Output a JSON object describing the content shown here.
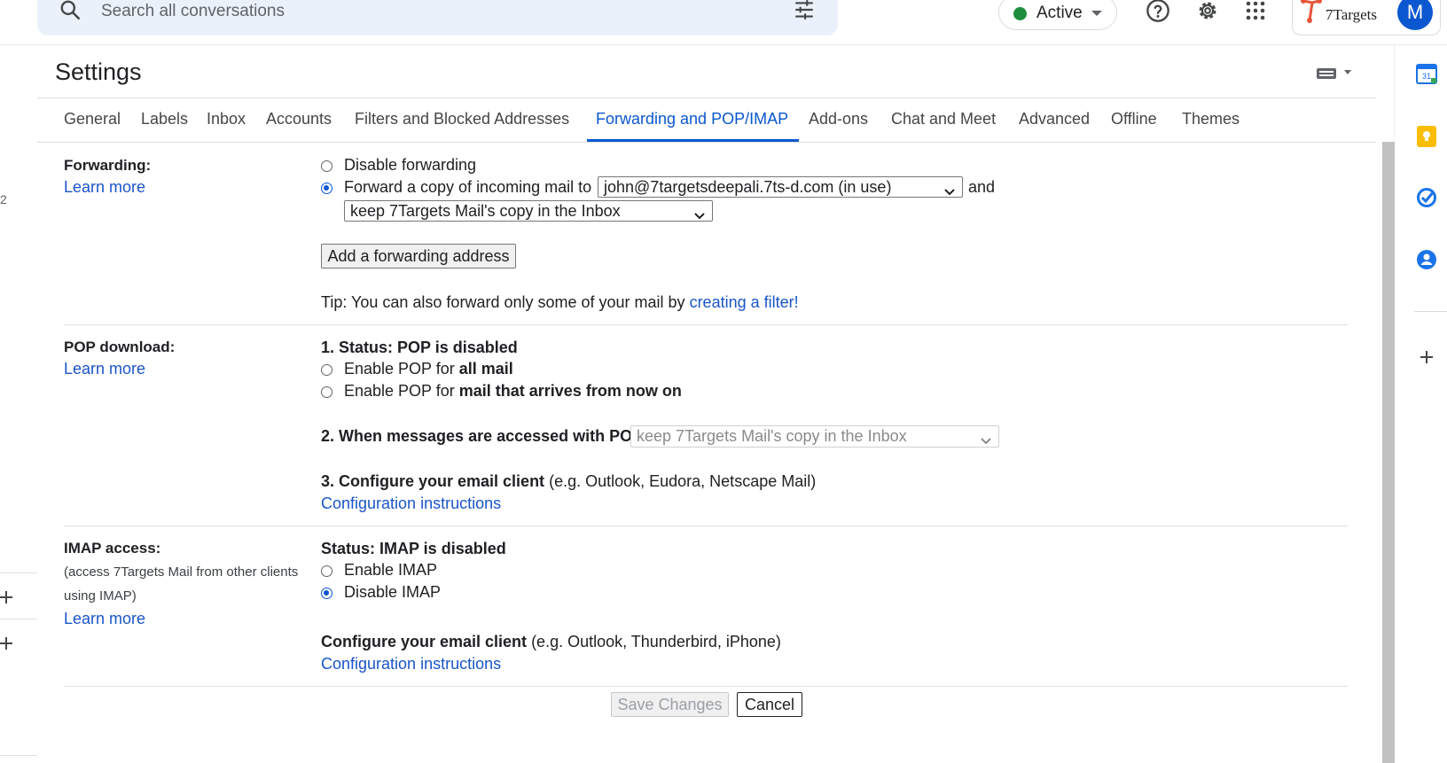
{
  "header": {
    "search_placeholder": "Search all conversations",
    "status_label": "Active",
    "brand_name": "7Targets",
    "avatar_letter": "M"
  },
  "left_fragment": "2",
  "settings": {
    "title": "Settings",
    "tabs": [
      "General",
      "Labels",
      "Inbox",
      "Accounts",
      "Filters and Blocked Addresses",
      "Forwarding and POP/IMAP",
      "Add-ons",
      "Chat and Meet",
      "Advanced",
      "Offline",
      "Themes"
    ],
    "active_tab": "Forwarding and POP/IMAP"
  },
  "forwarding": {
    "label": "Forwarding:",
    "learn_more": "Learn more",
    "option_disable": "Disable forwarding",
    "option_forward": "Forward a copy of incoming mail to",
    "selected_option": "forward",
    "forward_address": "john@7targetsdeepali.7ts-d.com (in use)",
    "and_text": "and",
    "copy_action": "keep 7Targets Mail's copy in the Inbox",
    "add_address_button": "Add a forwarding address",
    "tip_text": "Tip: You can also forward only some of your mail by",
    "tip_link": "creating a filter!"
  },
  "pop": {
    "label": "POP download:",
    "learn_more": "Learn more",
    "status": "1. Status: POP is disabled",
    "enable_prefix": "Enable POP for",
    "enable_all_bold": "all mail",
    "enable_now_bold": "mail that arrives from now on",
    "when_accessed": "2. When messages are accessed with POP",
    "when_accessed_value": "keep 7Targets Mail's copy in the Inbox",
    "configure_bold": "3. Configure your email client",
    "configure_rest": "(e.g. Outlook, Eudora, Netscape Mail)",
    "config_link": "Configuration instructions"
  },
  "imap": {
    "label": "IMAP access:",
    "desc_line1": "(access 7Targets Mail from other clients",
    "desc_line2": "using IMAP)",
    "learn_more": "Learn more",
    "status": "Status: IMAP is disabled",
    "option_enable": "Enable IMAP",
    "option_disable": "Disable IMAP",
    "selected_option": "disable",
    "configure_bold": "Configure your email client",
    "configure_rest": "(e.g. Outlook, Thunderbird, iPhone)",
    "config_link": "Configuration instructions"
  },
  "footer": {
    "save_button": "Save Changes",
    "cancel_button": "Cancel"
  },
  "colors": {
    "accent": "#0b57d0",
    "link": "#1a55c8",
    "status_active": "#1e8e3e"
  },
  "icons": [
    "search-icon",
    "tune-icon",
    "help-icon",
    "gear-icon",
    "apps-icon",
    "calendar-icon",
    "keep-icon",
    "tasks-icon",
    "contacts-icon",
    "plus-icon",
    "keyboard-icon"
  ]
}
